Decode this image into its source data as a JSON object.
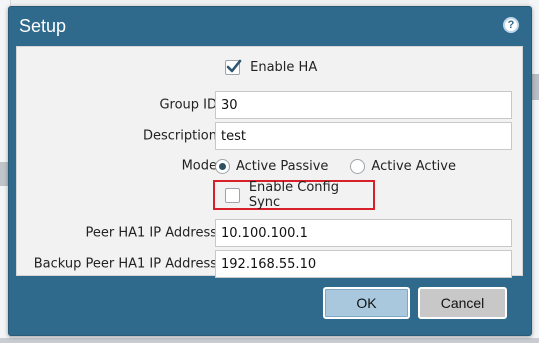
{
  "dialog": {
    "title": "Setup",
    "help_icon": "question-mark-icon",
    "title_bar_color": "#2f6a8c"
  },
  "form": {
    "enable_ha": {
      "label": "Enable HA",
      "checked": true
    },
    "group_id": {
      "label": "Group ID",
      "value": "30"
    },
    "description": {
      "label": "Description",
      "value": "test"
    },
    "mode": {
      "label": "Mode",
      "options": [
        {
          "label": "Active Passive",
          "selected": true
        },
        {
          "label": "Active Active",
          "selected": false
        }
      ]
    },
    "enable_config_sync": {
      "label": "Enable Config Sync",
      "checked": false,
      "highlight_color": "#d8202a"
    },
    "peer_ha1_ip": {
      "label": "Peer HA1 IP Address",
      "value": "10.100.100.1"
    },
    "backup_peer_ha1_ip": {
      "label": "Backup Peer HA1 IP Address",
      "value": "192.168.55.10"
    }
  },
  "footer": {
    "ok_label": "OK",
    "cancel_label": "Cancel"
  }
}
